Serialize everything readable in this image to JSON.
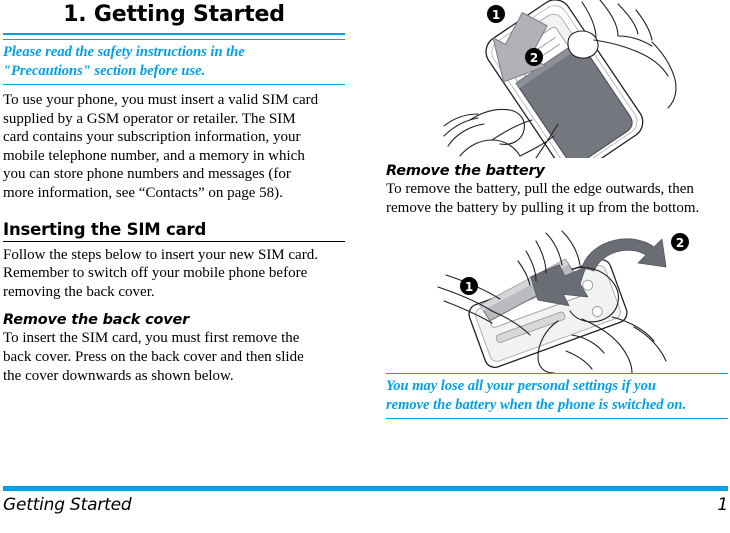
{
  "document": {
    "chapter_title": "1. Getting Started"
  },
  "left_column": {
    "callout": {
      "line1": "Please read the safety instructions in the",
      "line2": "\"Precautions\" section before use.",
      "color": "#00A0E8"
    },
    "intro_paragraph": {
      "line1": "To use your phone, you must insert a valid SIM card",
      "line2": "supplied by a GSM operator or retailer. The SIM",
      "line3": "card contains your subscription information, your",
      "line4": "mobile telephone number, and a memory in which",
      "line5": "you can store phone numbers and messages (for",
      "line6": "more information, see “Contacts” on page 58)."
    },
    "section_heading": "Inserting the SIM card",
    "section_paragraph": {
      "line1": "Follow the steps below to insert your new SIM card.",
      "line2": "Remember to switch off your mobile phone before",
      "line3": "removing the back cover."
    },
    "sub_heading": "Remove the back cover",
    "sub_paragraph": {
      "line1": "To insert the SIM card, you must first remove the",
      "line2": "back cover. Press on the back cover and then slide",
      "line3": "the cover downwards as shown below."
    }
  },
  "right_column": {
    "illustration_back_cover": {
      "caption_alt": "Hand sliding the back cover off the phone",
      "badge_1": "1",
      "badge_2": "2"
    },
    "sub_heading": "Remove the battery",
    "sub_paragraph": {
      "line1": "To remove the battery, pull the edge outwards, then",
      "line2": "remove the battery by pulling it up from the bottom."
    },
    "illustration_battery": {
      "caption_alt": "Hand pulling the battery out of the phone",
      "badge_1": "1",
      "badge_2": "2"
    },
    "warning": {
      "line1": "You may lose all your personal settings if you",
      "line2": "remove the battery when the phone is switched on.",
      "color": "#00A0E8"
    }
  },
  "footer": {
    "label": "Getting Started",
    "page_number": "1",
    "rule_color": "#00A0E8"
  }
}
